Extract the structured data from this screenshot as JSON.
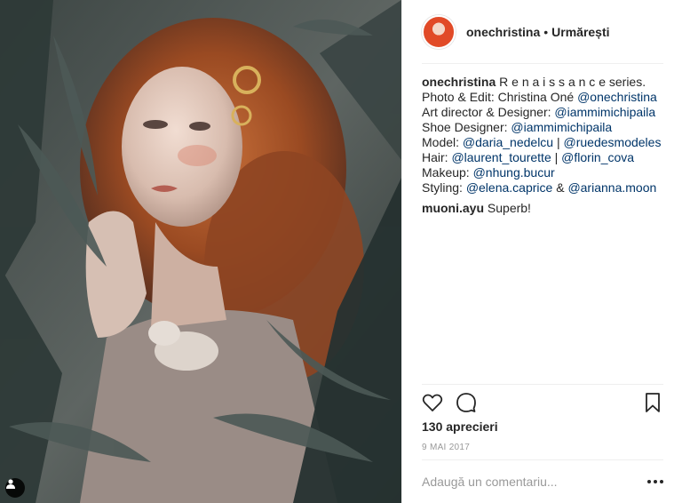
{
  "header": {
    "username": "onechristina",
    "separator": "•",
    "follow_status": "Urmărești"
  },
  "caption": {
    "author": "onechristina",
    "text": "R e n a i s s a n c e series.",
    "lines": [
      {
        "label": "Photo & Edit: Christina Oné ",
        "mentions": [
          "@onechristina"
        ]
      },
      {
        "label": "Art director & Designer: ",
        "mentions": [
          "@iammimichipaila"
        ]
      },
      {
        "label": "Shoe Designer: ",
        "mentions": [
          "@iammimichipaila"
        ]
      },
      {
        "label": "Model: ",
        "mentions": [
          "@daria_nedelcu",
          "@ruedesmodeles"
        ],
        "joiner": " | "
      },
      {
        "label": "Hair: ",
        "mentions": [
          "@laurent_tourette",
          "@florin_cova"
        ],
        "joiner": " | "
      },
      {
        "label": "Makeup: ",
        "mentions": [
          "@nhung.bucur"
        ]
      },
      {
        "label": "Styling: ",
        "mentions": [
          "@elena.caprice",
          "@arianna.moon"
        ],
        "joiner": " & "
      }
    ]
  },
  "comments": [
    {
      "author": "muoni.ayu",
      "text": "Superb!"
    }
  ],
  "actions": {
    "like_icon": "heart-icon",
    "comment_icon": "comment-bubble-icon",
    "save_icon": "bookmark-icon"
  },
  "likes": "130 aprecieri",
  "date": "9 MAI 2017",
  "add_comment": {
    "placeholder": "Adaugă un comentariu...",
    "more_icon": "more-options-icon"
  },
  "photo": {
    "tag_icon": "user-tag-icon"
  },
  "colors": {
    "text": "#262626",
    "link": "#003569",
    "muted": "#999999",
    "divider": "#efefef"
  }
}
